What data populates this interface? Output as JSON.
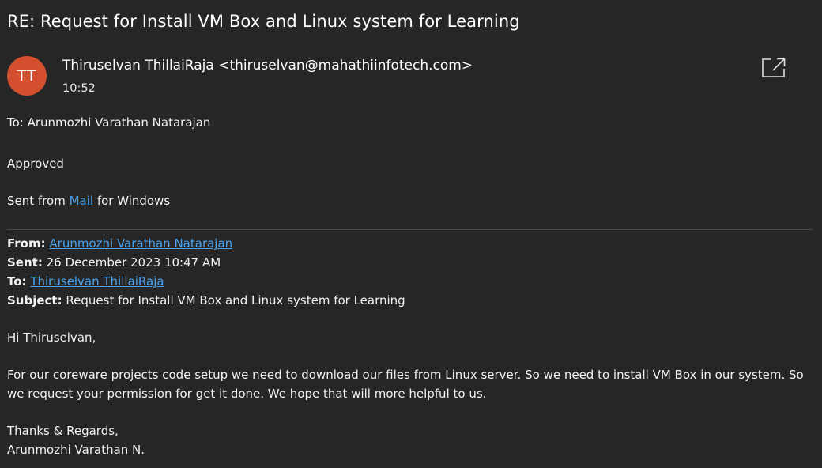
{
  "email": {
    "subject": "RE: Request for Install VM Box and Linux system for Learning",
    "avatar_initials": "TT",
    "avatar_color": "#d44f2e",
    "sender": "Thiruselvan ThillaiRaja <thiruselvan@mahathiinfotech.com>",
    "time": "10:52",
    "popout_icon": "open-in-new-window-icon",
    "to_line": "To: Arunmozhi Varathan Natarajan",
    "reply_body": "Approved",
    "sent_from_prefix": "Sent from ",
    "sent_from_link": "Mail",
    "sent_from_suffix": " for Windows"
  },
  "quoted": {
    "from_label": "From:",
    "from_value": "Arunmozhi Varathan Natarajan",
    "sent_label": "Sent:",
    "sent_value": "26 December 2023 10:47 AM",
    "to_label": "To:",
    "to_value": "Thiruselvan ThillaiRaja",
    "subject_label": "Subject:",
    "subject_value": "Request for Install VM Box and Linux system for Learning",
    "greeting": "Hi Thiruselvan,",
    "body": "For our coreware projects code setup we need to download our files from Linux server. So we need to install VM Box in our system. So we request your permission for get it done. We hope that will more helpful to us.",
    "closing": "Thanks & Regards,",
    "signature": "Arunmozhi Varathan N."
  },
  "colors": {
    "background": "#262626",
    "link": "#4aa3f0",
    "divider": "#4a4a4a"
  }
}
